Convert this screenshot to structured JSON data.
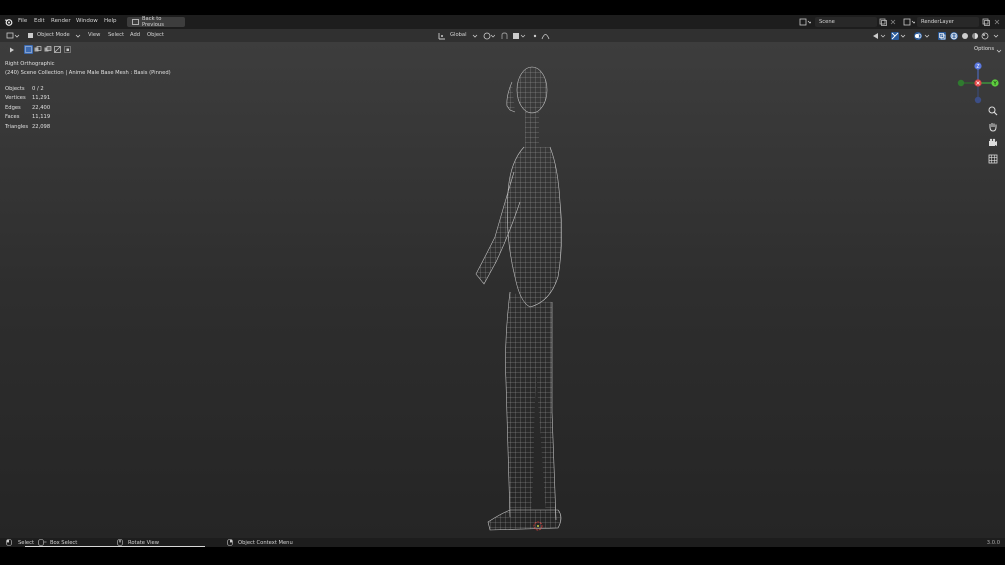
{
  "menubar": {
    "items": [
      "File",
      "Edit",
      "Render",
      "Window",
      "Help"
    ],
    "back_button": "Back to Previous",
    "scene": "Scene",
    "render_layer": "RenderLayer"
  },
  "header": {
    "mode": "Object Mode",
    "menus": [
      "View",
      "Select",
      "Add",
      "Object"
    ],
    "orientation": "Global",
    "options": "Options"
  },
  "viewport": {
    "view_name": "Right Orthographic",
    "collection": "(240) Scene Collection | Anime Male Base Mesh : Basis (Pinned)",
    "stats": [
      {
        "label": "Objects",
        "value": "0 / 2"
      },
      {
        "label": "Vertices",
        "value": "11,291"
      },
      {
        "label": "Edges",
        "value": "22,400"
      },
      {
        "label": "Faces",
        "value": "11,119"
      },
      {
        "label": "Triangles",
        "value": "22,098"
      }
    ],
    "gizmo": {
      "z": "Z",
      "y": "Y"
    }
  },
  "statusbar": {
    "select": "Select",
    "box_select": "Box Select",
    "rotate_view": "Rotate View",
    "context_menu": "Object Context Menu",
    "version": "3.0.0"
  }
}
